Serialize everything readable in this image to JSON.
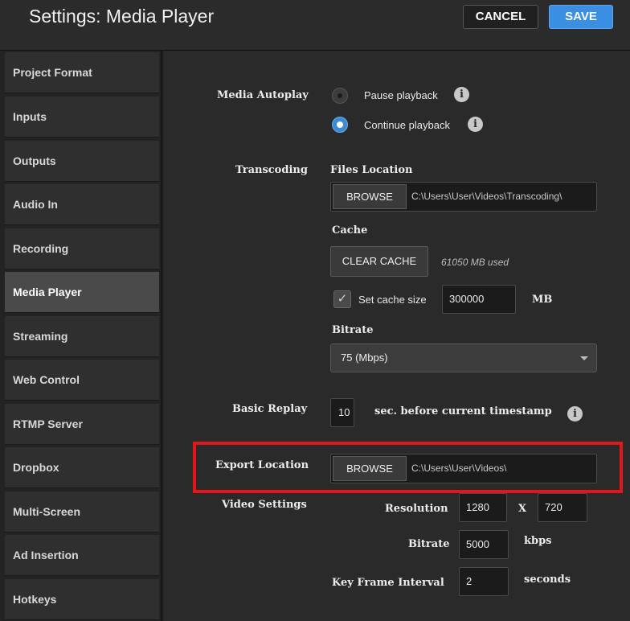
{
  "header": {
    "title": "Settings: Media Player",
    "cancel_label": "CANCEL",
    "save_label": "SAVE"
  },
  "sidebar": {
    "items": [
      {
        "label": "Project Format"
      },
      {
        "label": "Inputs"
      },
      {
        "label": "Outputs"
      },
      {
        "label": "Audio In"
      },
      {
        "label": "Recording"
      },
      {
        "label": "Media Player",
        "active": true
      },
      {
        "label": "Streaming"
      },
      {
        "label": "Web Control"
      },
      {
        "label": "RTMP Server"
      },
      {
        "label": "Dropbox"
      },
      {
        "label": "Multi-Screen"
      },
      {
        "label": "Ad Insertion"
      },
      {
        "label": "Hotkeys"
      }
    ]
  },
  "media_autoplay": {
    "label": "Media Autoplay",
    "options": [
      {
        "label": "Pause playback",
        "selected": false
      },
      {
        "label": "Continue playback",
        "selected": true
      }
    ],
    "info_icon": "info-icon"
  },
  "transcoding": {
    "label": "Transcoding",
    "files_location_label": "Files Location",
    "browse_label": "BROWSE",
    "files_path": "C:\\Users\\User\\Videos\\Transcoding\\",
    "cache_label": "Cache",
    "clear_cache_label": "CLEAR CACHE",
    "cache_used": "61050 MB used",
    "set_cache_label": "Set cache size",
    "set_cache_checked": true,
    "cache_size_value": "300000",
    "cache_unit": "MB",
    "bitrate_label": "Bitrate",
    "bitrate_value": "75 (Mbps)"
  },
  "basic_replay": {
    "label": "Basic Replay",
    "value": "10",
    "suffix": "sec. before current timestamp"
  },
  "export_location": {
    "label": "Export Location",
    "browse_label": "BROWSE",
    "path": "C:\\Users\\User\\Videos\\",
    "highlight_color": "#e3161c"
  },
  "video_settings": {
    "label": "Video Settings",
    "resolution_label": "Resolution",
    "width": "1280",
    "x_label": "X",
    "height": "720",
    "bitrate_label": "Bitrate",
    "bitrate_value": "5000",
    "bitrate_unit": "kbps",
    "keyframe_label": "Key Frame Interval",
    "keyframe_value": "2",
    "keyframe_unit": "seconds"
  },
  "colors": {
    "accent": "#3a8fe3",
    "background": "#2a2a2a",
    "sidebar_active": "#4a4a4a"
  }
}
